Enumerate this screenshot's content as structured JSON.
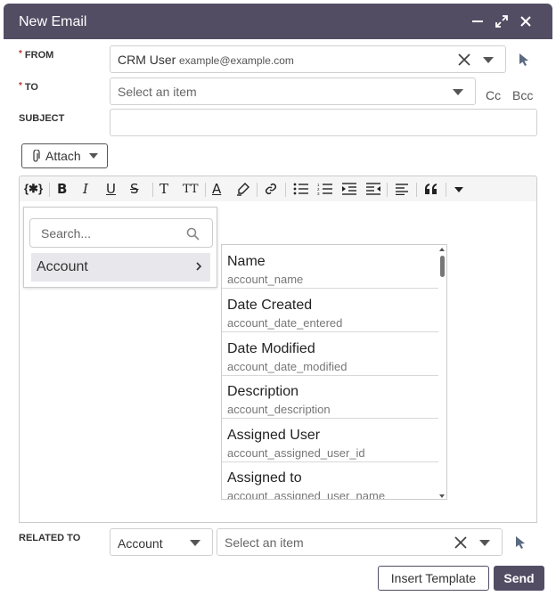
{
  "dialog": {
    "title": "New Email"
  },
  "from": {
    "label": "FROM",
    "value_name": "CRM User",
    "value_email": "example@example.com"
  },
  "to": {
    "label": "TO",
    "placeholder": "Select an item",
    "cc_label": "Cc",
    "bcc_label": "Bcc"
  },
  "subject": {
    "label": "SUBJECT",
    "value": ""
  },
  "attach": {
    "label": "Attach"
  },
  "toolbar": {
    "buttons": [
      "variables",
      "bold",
      "italic",
      "underline",
      "strikethrough",
      "font-size",
      "font-size-small",
      "text-color",
      "highlight",
      "link",
      "bullet-list",
      "numbered-list",
      "indent",
      "outdent",
      "align",
      "blockquote",
      "more"
    ]
  },
  "variables": {
    "search_placeholder": "Search...",
    "module": "Account",
    "fields": [
      {
        "name": "Name",
        "key": "account_name"
      },
      {
        "name": "Date Created",
        "key": "account_date_entered"
      },
      {
        "name": "Date Modified",
        "key": "account_date_modified"
      },
      {
        "name": "Description",
        "key": "account_description"
      },
      {
        "name": "Assigned User",
        "key": "account_assigned_user_id"
      },
      {
        "name": "Assigned to",
        "key": "account_assigned_user_name"
      }
    ]
  },
  "related_to": {
    "label": "RELATED TO",
    "module_value": "Account",
    "placeholder": "Select an item"
  },
  "footer": {
    "insert_template_label": "Insert Template",
    "send_label": "Send"
  },
  "colors": {
    "header": "#534d64",
    "required": "#c0392b"
  }
}
